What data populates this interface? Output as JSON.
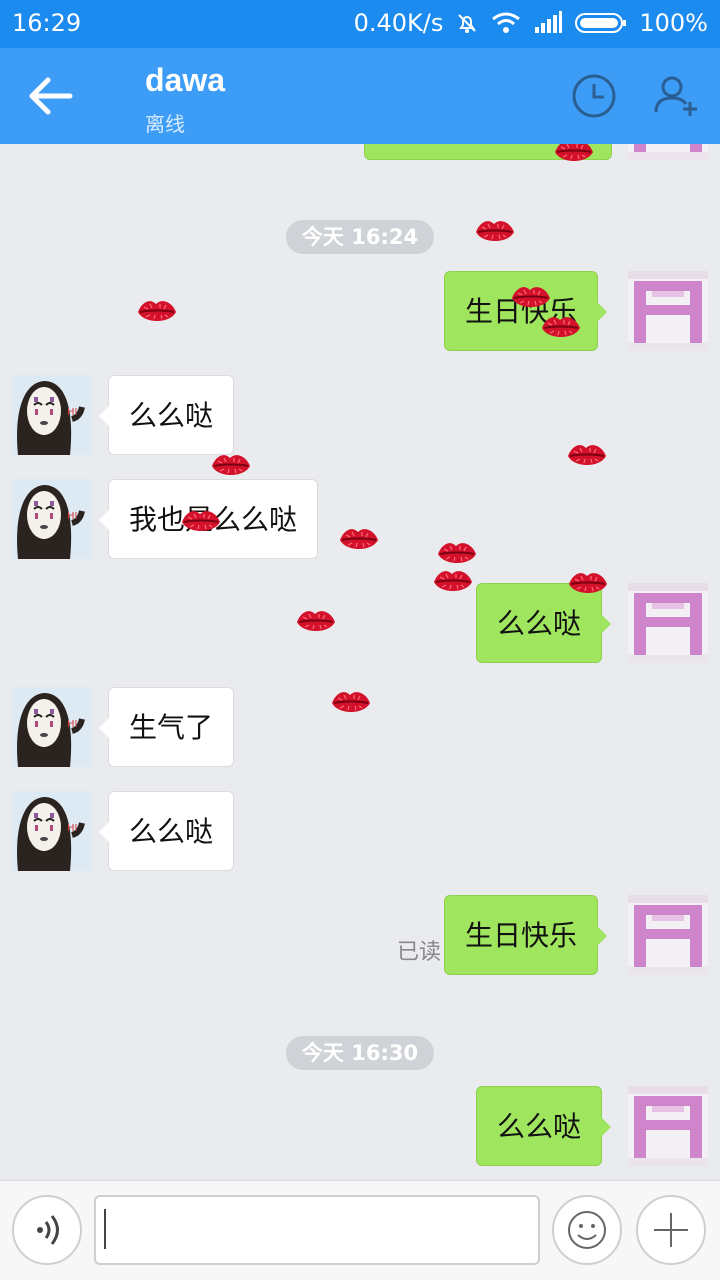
{
  "status": {
    "time": "16:29",
    "net_speed": "0.40K/s",
    "battery": "100%"
  },
  "header": {
    "title": "dawa",
    "subtitle": "离线",
    "back_icon": "arrow-left-icon",
    "history_icon": "clock-icon",
    "add_icon": "add-user-icon",
    "color": "#3c9cf6"
  },
  "chat": {
    "timestamp_1": "今天 16:24",
    "timestamp_2": "今天 16:30",
    "messages": [
      {
        "dir": "out",
        "text": "生日快乐"
      },
      {
        "dir": "in",
        "text": "么么哒"
      },
      {
        "dir": "in",
        "text": "我也是么么哒"
      },
      {
        "dir": "out",
        "text": "么么哒"
      },
      {
        "dir": "in",
        "text": "生气了"
      },
      {
        "dir": "in",
        "text": "么么哒"
      },
      {
        "dir": "out",
        "text": "生日快乐",
        "status": "已读"
      },
      {
        "dir": "out",
        "text": "么么哒"
      }
    ],
    "bubble_out_color": "#9fe65e",
    "effect_icon": "kiss-lips-icon"
  },
  "input": {
    "value": "",
    "voice_icon": "voice-icon",
    "emoji_icon": "smiley-icon",
    "plus_icon": "plus-icon"
  }
}
